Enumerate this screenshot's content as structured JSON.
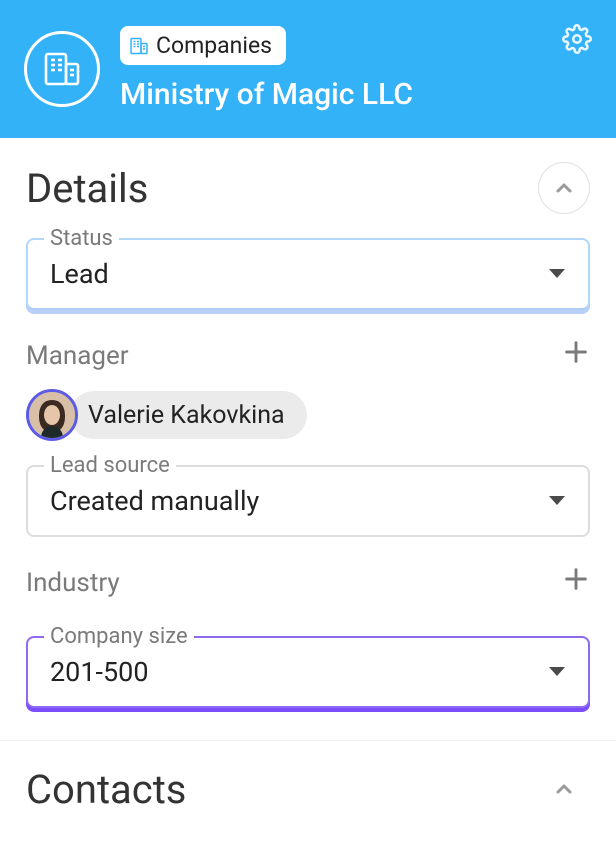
{
  "header": {
    "breadcrumb": "Companies",
    "title": "Ministry of Magic LLC"
  },
  "details": {
    "section_title": "Details",
    "status": {
      "label": "Status",
      "value": "Lead"
    },
    "manager": {
      "label": "Manager",
      "name": "Valerie Kakovkina"
    },
    "lead_source": {
      "label": "Lead source",
      "value": "Created manually"
    },
    "industry": {
      "label": "Industry"
    },
    "company_size": {
      "label": "Company size",
      "value": "201-500"
    }
  },
  "contacts": {
    "section_title": "Contacts"
  }
}
